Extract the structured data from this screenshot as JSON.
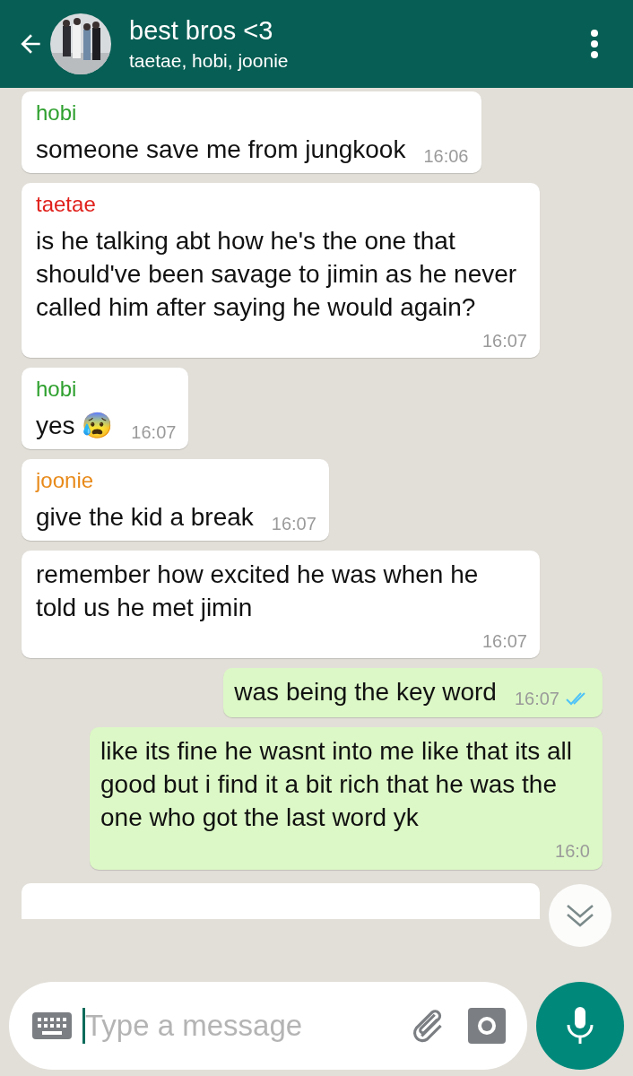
{
  "header": {
    "title": "best bros <3",
    "subtitle": "taetae, hobi, joonie"
  },
  "messages": [
    {
      "kind": "incoming",
      "sender": "hobi",
      "color": "#2ea02e",
      "text": "someone save me from jungkook",
      "time": "16:06"
    },
    {
      "kind": "incoming",
      "sender": "taetae",
      "color": "#e0201b",
      "text": "is he talking abt how he's the one that should've been savage to jimin as he never called him after saying he would again?",
      "time": "16:07"
    },
    {
      "kind": "incoming",
      "sender": "hobi",
      "color": "#2ea02e",
      "text": "yes 😰",
      "time": "16:07"
    },
    {
      "kind": "incoming",
      "sender": "joonie",
      "color": "#e88a1a",
      "text": "give the kid a break",
      "time": "16:07"
    },
    {
      "kind": "incoming",
      "text": "remember how excited he was when he told us he met jimin",
      "time": "16:07"
    },
    {
      "kind": "outgoing",
      "text": "was being the key word",
      "time": "16:07",
      "read": true
    },
    {
      "kind": "outgoing",
      "text": "like its fine he wasnt into me like that its all good but i find it a bit rich that he was the one who got the last word yk",
      "time": "16:0"
    }
  ],
  "composer": {
    "placeholder": "Type a message"
  }
}
